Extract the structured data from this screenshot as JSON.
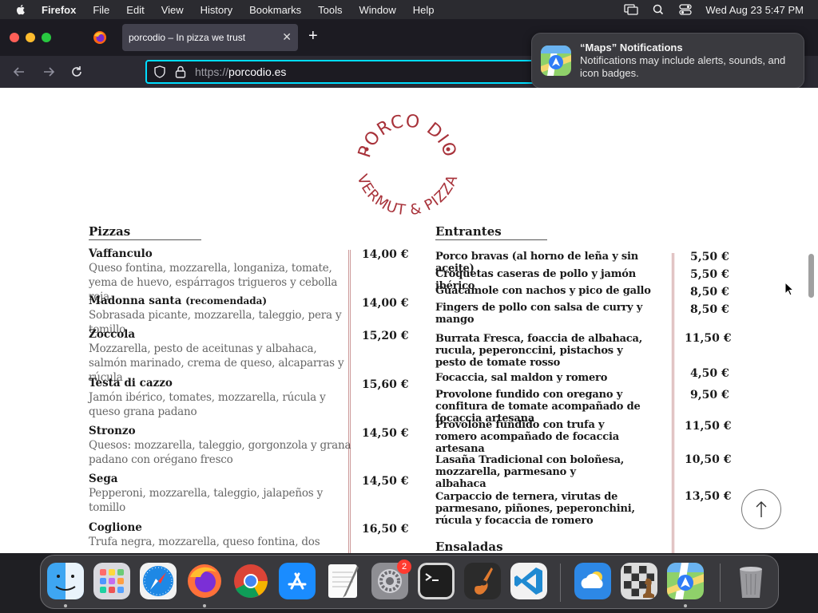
{
  "menubar": {
    "app_name": "Firefox",
    "items": [
      "File",
      "Edit",
      "View",
      "History",
      "Bookmarks",
      "Tools",
      "Window",
      "Help"
    ],
    "clock": "Wed Aug 23  5:47 PM"
  },
  "browser": {
    "tab_title": "porcodio – In pizza we trust",
    "tab_close": "✕",
    "new_tab": "+",
    "url_protocol": "https://",
    "url_host": "porcodio.es"
  },
  "notification": {
    "title": "“Maps” Notifications",
    "body": "Notifications may include alerts, sounds, and icon badges."
  },
  "menu": {
    "logo_top": "PORCO DIO",
    "logo_bottom": "VERMUT & PIZZA",
    "pizzas_title": "Pizzas",
    "pizzas": [
      {
        "name": "Vaffanculo",
        "desc": "Queso fontina, mozzarella, longaniza, tomate, yema de huevo, espárragos trigueros y cebolla roja",
        "price": "14,00 €"
      },
      {
        "name": "Madonna santa",
        "note": "(recomendada)",
        "desc": "Sobrasada picante, mozzarella, taleggio, pera y tomillo",
        "price": "14,00 €"
      },
      {
        "name": "Zoccola",
        "desc": "Mozzarella, pesto de aceitunas y albahaca, salmón marinado, crema de queso, alcaparras y rúcula",
        "price": "15,20 €"
      },
      {
        "name": "Testa di cazzo",
        "desc": "Jamón ibérico, tomates, mozzarella, rúcula y queso grana padano",
        "price": "15,60 €"
      },
      {
        "name": "Stronzo",
        "desc": "Quesos: mozzarella, taleggio, gorgonzola y grana padano con orégano fresco",
        "price": "14,50 €"
      },
      {
        "name": "Sega",
        "desc": "Pepperoni, mozzarella, taleggio, jalapeños y tomillo",
        "price": "14,50 €"
      },
      {
        "name": "Coglione",
        "desc": "Trufa negra, mozzarella, queso fontina, dos",
        "price": "16,50 €"
      }
    ],
    "entrantes_title": "Entrantes",
    "entrantes": [
      {
        "name": "Porco bravas (al horno de leña y sin aceite)",
        "price": "5,50 €"
      },
      {
        "name": "Croquetas caseras de pollo y jamón ibérico",
        "price": "5,50 €"
      },
      {
        "name": "Guacamole con nachos y pico de gallo",
        "price": "8,50 €"
      },
      {
        "name": "Fingers de pollo con salsa de curry y mango",
        "price": "8,50 €"
      },
      {
        "name": "Burrata Fresca, foaccia de albahaca, rucula, peperonccini, pistachos y pesto de tomate rosso",
        "price": "11,50 €"
      },
      {
        "name": "Focaccia, sal maldon y romero",
        "price": "4,50 €"
      },
      {
        "name": "Provolone fundido con oregano y confitura de tomate acompañado de focaccia artesana",
        "price": "9,50 €"
      },
      {
        "name": "Provolone fundido con trufa y romero acompañado de focaccia artesana",
        "price": "11,50 €"
      },
      {
        "name": "Lasaña Tradicional con boloñesa, mozzarella, parmesano y albahaca",
        "price": "10,50 €"
      },
      {
        "name": "Carpaccio de ternera, virutas de parmesano, piñones, peperonchini, rúcula y focaccia de romero",
        "price": "13,50 €"
      }
    ],
    "ensaladas_title": "Ensaladas"
  },
  "dock": {
    "items": [
      "finder-icon",
      "launchpad-icon",
      "safari-icon",
      "firefox-icon",
      "chrome-icon",
      "app-store-icon",
      "textedit-icon",
      "system-settings-icon",
      "terminal-icon",
      "garageband-icon",
      "vscode-icon",
      "weather-icon",
      "chess-icon",
      "maps-icon",
      "trash-icon"
    ],
    "settings_badge": "2"
  },
  "colors": {
    "accent": "#00ddff",
    "logo_red": "#a8323a",
    "divider": "#cc9999"
  }
}
